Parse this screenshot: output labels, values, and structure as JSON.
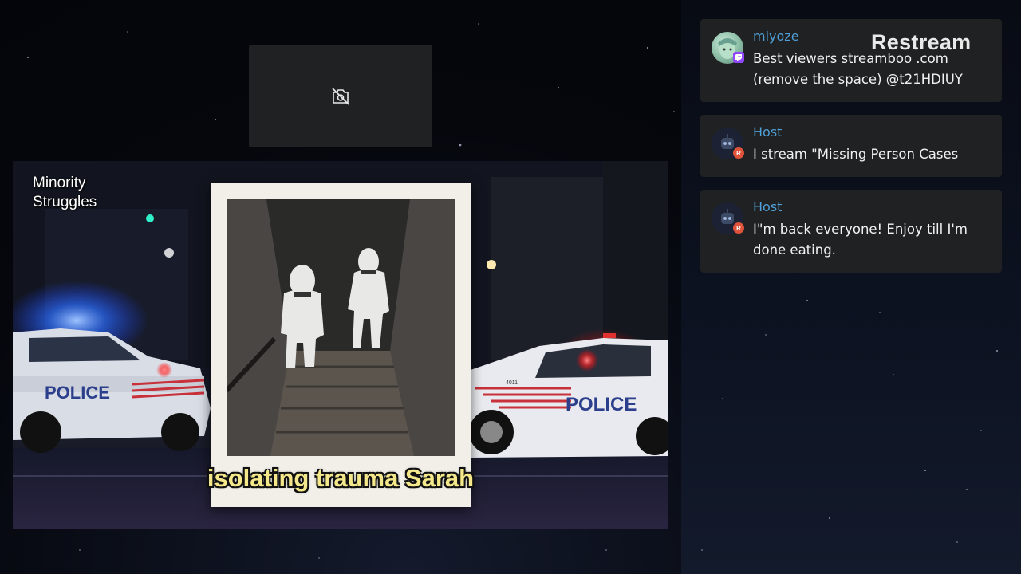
{
  "brand": {
    "logo_text": "Restream"
  },
  "stream": {
    "overlay_label": "Minority Struggles",
    "subtitle": "isolating trauma Sarah",
    "police_text_left": "POLICE",
    "police_text_right": "POLICE",
    "car_number": "4011"
  },
  "camera": {
    "icon": "camera-off-icon"
  },
  "chat": {
    "messages": [
      {
        "name": "miyoze",
        "platform": "twitch",
        "text": "Best viewers streamboo .com (remove the space) @t21HDIUY"
      },
      {
        "name": "Host",
        "platform": "restream",
        "text": "I stream \"Missing Person Cases"
      },
      {
        "name": "Host",
        "platform": "restream",
        "text": "I\"m back everyone! Enjoy till I'm done eating."
      }
    ]
  },
  "colors": {
    "chat_name": "#4f9fd6",
    "twitch": "#9146ff",
    "restream_badge": "#e0533b",
    "subtitle": "#f4e88a"
  }
}
